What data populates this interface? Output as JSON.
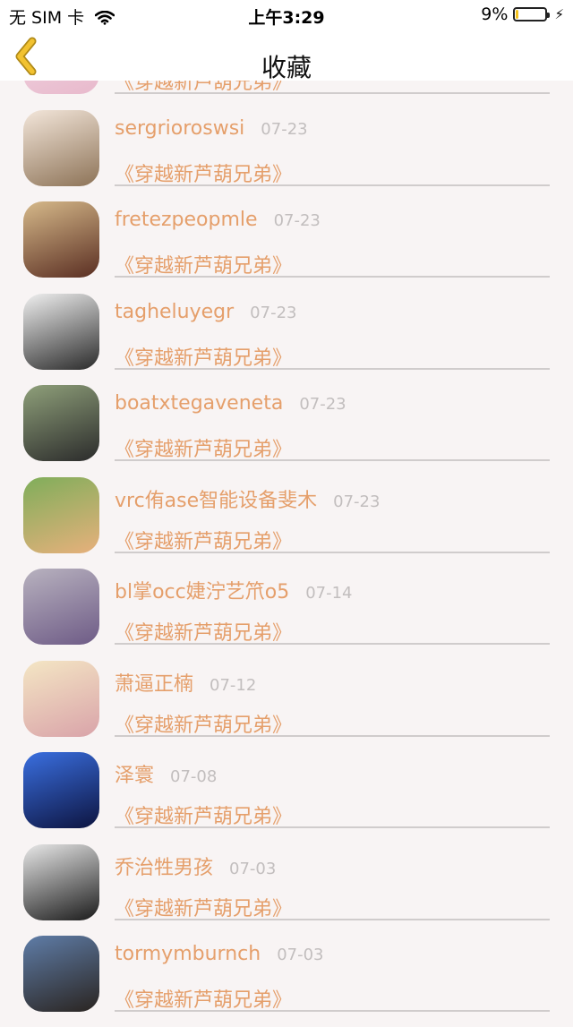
{
  "status_bar": {
    "carrier": "无 SIM 卡",
    "time": "上午3:29",
    "battery": "9%",
    "battery_level": 0.09,
    "battery_color": "#f4c21d"
  },
  "nav": {
    "title": "收藏",
    "back_icon": "chevron-left-icon",
    "accent": "#f2c230"
  },
  "items": [
    {
      "name": "",
      "date": "",
      "title": "《穿越新芦葫兄弟》",
      "avatar": [
        "#f2d9e4",
        "#e8b9cc"
      ]
    },
    {
      "name": "sergrioroswsi",
      "date": "07-23",
      "title": "《穿越新芦葫兄弟》",
      "avatar": [
        "#f3e6da",
        "#8d7357"
      ]
    },
    {
      "name": "fretezpeopmle",
      "date": "07-23",
      "title": "《穿越新芦葫兄弟》",
      "avatar": [
        "#d6b98a",
        "#5a2e22"
      ]
    },
    {
      "name": "tagheluyegr",
      "date": "07-23",
      "title": "《穿越新芦葫兄弟》",
      "avatar": [
        "#f0f0f0",
        "#2a2a2a"
      ]
    },
    {
      "name": "boatxtegaveneta",
      "date": "07-23",
      "title": "《穿越新芦葫兄弟》",
      "avatar": [
        "#8fa07a",
        "#2b2b2b"
      ]
    },
    {
      "name": "vrc侑ase智能设备斐木",
      "date": "07-23",
      "title": "《穿越新芦葫兄弟》",
      "avatar": [
        "#7fae5a",
        "#e7b07c"
      ]
    },
    {
      "name": "bl掌occ婕泞艺笊o5",
      "date": "07-14",
      "title": "《穿越新芦葫兄弟》",
      "avatar": [
        "#b8b2bf",
        "#6e5b86"
      ]
    },
    {
      "name": "萧逼正楠",
      "date": "07-12",
      "title": "《穿越新芦葫兄弟》",
      "avatar": [
        "#f4e6c4",
        "#d9a3a9"
      ]
    },
    {
      "name": "泽寰",
      "date": "07-08",
      "title": "《穿越新芦葫兄弟》",
      "avatar": [
        "#3a6fe0",
        "#0d1440"
      ]
    },
    {
      "name": "乔治牲男孩",
      "date": "07-03",
      "title": "《穿越新芦葫兄弟》",
      "avatar": [
        "#e8e8e8",
        "#1b1b1b"
      ]
    },
    {
      "name": "tormymburnch",
      "date": "07-03",
      "title": "《穿越新芦葫兄弟》",
      "avatar": [
        "#5f7da8",
        "#2a2420"
      ]
    }
  ]
}
